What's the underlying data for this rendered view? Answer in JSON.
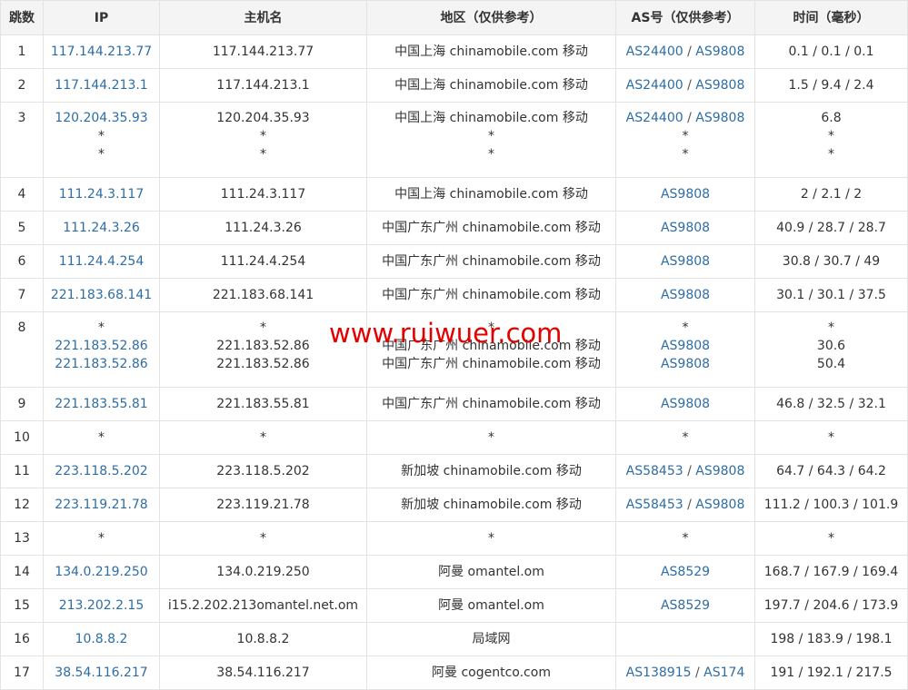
{
  "headers": [
    "跳数",
    "IP",
    "主机名",
    "地区（仅供参考）",
    "AS号（仅供参考）",
    "时间（毫秒）"
  ],
  "rows": [
    {
      "hop": "1",
      "ip": [
        "117.144.213.77"
      ],
      "host": [
        "117.144.213.77"
      ],
      "region": [
        "中国上海 chinamobile.com 移动"
      ],
      "as": [
        [
          "AS24400",
          "AS9808"
        ]
      ],
      "time": [
        "0.1 / 0.1 / 0.1"
      ]
    },
    {
      "hop": "2",
      "ip": [
        "117.144.213.1"
      ],
      "host": [
        "117.144.213.1"
      ],
      "region": [
        "中国上海 chinamobile.com 移动"
      ],
      "as": [
        [
          "AS24400",
          "AS9808"
        ]
      ],
      "time": [
        "1.5 / 9.4 / 2.4"
      ]
    },
    {
      "hop": "3",
      "ip": [
        "120.204.35.93",
        "*",
        "*"
      ],
      "host": [
        "120.204.35.93",
        "*",
        "*"
      ],
      "region": [
        "中国上海 chinamobile.com 移动",
        "*",
        "*"
      ],
      "as": [
        [
          "AS24400",
          "AS9808"
        ],
        [
          "*"
        ],
        [
          "*"
        ]
      ],
      "time": [
        "6.8",
        "*",
        "*"
      ]
    },
    {
      "hop": "4",
      "ip": [
        "111.24.3.117"
      ],
      "host": [
        "111.24.3.117"
      ],
      "region": [
        "中国上海 chinamobile.com 移动"
      ],
      "as": [
        [
          "AS9808"
        ]
      ],
      "time": [
        "2 / 2.1 / 2"
      ]
    },
    {
      "hop": "5",
      "ip": [
        "111.24.3.26"
      ],
      "host": [
        "111.24.3.26"
      ],
      "region": [
        "中国广东广州 chinamobile.com 移动"
      ],
      "as": [
        [
          "AS9808"
        ]
      ],
      "time": [
        "40.9 / 28.7 / 28.7"
      ]
    },
    {
      "hop": "6",
      "ip": [
        "111.24.4.254"
      ],
      "host": [
        "111.24.4.254"
      ],
      "region": [
        "中国广东广州 chinamobile.com 移动"
      ],
      "as": [
        [
          "AS9808"
        ]
      ],
      "time": [
        "30.8 / 30.7 / 49"
      ]
    },
    {
      "hop": "7",
      "ip": [
        "221.183.68.141"
      ],
      "host": [
        "221.183.68.141"
      ],
      "region": [
        "中国广东广州 chinamobile.com 移动"
      ],
      "as": [
        [
          "AS9808"
        ]
      ],
      "time": [
        "30.1 / 30.1 / 37.5"
      ]
    },
    {
      "hop": "8",
      "ip": [
        "*",
        "221.183.52.86",
        "221.183.52.86"
      ],
      "host": [
        "*",
        "221.183.52.86",
        "221.183.52.86"
      ],
      "region": [
        "*",
        "中国广东广州 chinamobile.com 移动",
        "中国广东广州 chinamobile.com 移动"
      ],
      "as": [
        [
          "*"
        ],
        [
          "AS9808"
        ],
        [
          "AS9808"
        ]
      ],
      "time": [
        "*",
        "30.6",
        "50.4"
      ]
    },
    {
      "hop": "9",
      "ip": [
        "221.183.55.81"
      ],
      "host": [
        "221.183.55.81"
      ],
      "region": [
        "中国广东广州 chinamobile.com 移动"
      ],
      "as": [
        [
          "AS9808"
        ]
      ],
      "time": [
        "46.8 / 32.5 / 32.1"
      ]
    },
    {
      "hop": "10",
      "ip": [
        "*"
      ],
      "host": [
        "*"
      ],
      "region": [
        "*"
      ],
      "as": [
        [
          "*"
        ]
      ],
      "time": [
        "*"
      ]
    },
    {
      "hop": "11",
      "ip": [
        "223.118.5.202"
      ],
      "host": [
        "223.118.5.202"
      ],
      "region": [
        "新加坡 chinamobile.com 移动"
      ],
      "as": [
        [
          "AS58453",
          "AS9808"
        ]
      ],
      "time": [
        "64.7 / 64.3 / 64.2"
      ]
    },
    {
      "hop": "12",
      "ip": [
        "223.119.21.78"
      ],
      "host": [
        "223.119.21.78"
      ],
      "region": [
        "新加坡 chinamobile.com 移动"
      ],
      "as": [
        [
          "AS58453",
          "AS9808"
        ]
      ],
      "time": [
        "111.2 / 100.3 / 101.9"
      ]
    },
    {
      "hop": "13",
      "ip": [
        "*"
      ],
      "host": [
        "*"
      ],
      "region": [
        "*"
      ],
      "as": [
        [
          "*"
        ]
      ],
      "time": [
        "*"
      ]
    },
    {
      "hop": "14",
      "ip": [
        "134.0.219.250"
      ],
      "host": [
        "134.0.219.250"
      ],
      "region": [
        "阿曼 omantel.om"
      ],
      "as": [
        [
          "AS8529"
        ]
      ],
      "time": [
        "168.7 / 167.9 / 169.4"
      ]
    },
    {
      "hop": "15",
      "ip": [
        "213.202.2.15"
      ],
      "host": [
        "i15.2.202.213omantel.net.om"
      ],
      "region": [
        "阿曼 omantel.om"
      ],
      "as": [
        [
          "AS8529"
        ]
      ],
      "time": [
        "197.7 / 204.6 / 173.9"
      ]
    },
    {
      "hop": "16",
      "ip": [
        "10.8.8.2"
      ],
      "host": [
        "10.8.8.2"
      ],
      "region": [
        "局域网"
      ],
      "as": [
        []
      ],
      "time": [
        "198 / 183.9 / 198.1"
      ]
    },
    {
      "hop": "17",
      "ip": [
        "38.54.116.217"
      ],
      "host": [
        "38.54.116.217"
      ],
      "region": [
        "阿曼 cogentco.com"
      ],
      "as": [
        [
          "AS138915",
          "AS174"
        ]
      ],
      "time": [
        "191 / 192.1 / 217.5"
      ]
    }
  ],
  "as_separator": " / ",
  "watermark": "www.ruiwuer.com",
  "colors": {
    "link": "#2e6da4",
    "header_bg": "#f4f4f4",
    "border": "#e3e3e3",
    "watermark": "#e50000"
  }
}
